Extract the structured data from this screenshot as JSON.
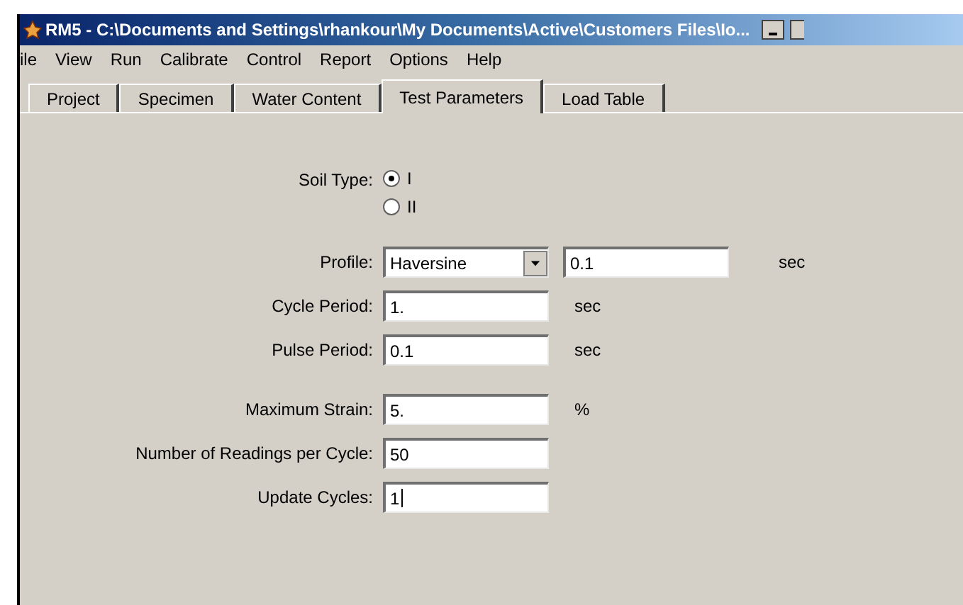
{
  "window": {
    "title": "RM5 - C:\\Documents and Settings\\rhankour\\My Documents\\Active\\Customers Files\\Io..."
  },
  "menu": [
    "ile",
    "View",
    "Run",
    "Calibrate",
    "Control",
    "Report",
    "Options",
    "Help"
  ],
  "tabs": [
    {
      "label": "Project",
      "selected": false
    },
    {
      "label": "Specimen",
      "selected": false
    },
    {
      "label": "Water Content",
      "selected": false
    },
    {
      "label": "Test Parameters",
      "selected": true
    },
    {
      "label": "Load Table",
      "selected": false
    }
  ],
  "groups": [
    [
      {
        "kind": "radio",
        "label": "Soil Type:",
        "options": [
          {
            "label": "I",
            "selected": true
          },
          {
            "label": "II",
            "selected": false
          }
        ]
      }
    ],
    [
      {
        "kind": "select",
        "label": "Profile:",
        "value": "Haversine",
        "extra": "0.1",
        "unit": "sec"
      },
      {
        "kind": "input",
        "label": "Cycle Period:",
        "value": "1.",
        "unit": "sec",
        "focused": false
      },
      {
        "kind": "input",
        "label": "Pulse Period:",
        "value": "0.1",
        "unit": "sec",
        "focused": false
      }
    ],
    [
      {
        "kind": "input",
        "label": "Maximum Strain:",
        "value": "5.",
        "unit": "%",
        "focused": false
      },
      {
        "kind": "input",
        "label": "Number of Readings per Cycle:",
        "value": "50",
        "focused": false
      },
      {
        "kind": "input",
        "label": "Update Cycles:",
        "value": "1",
        "focused": true
      }
    ]
  ]
}
